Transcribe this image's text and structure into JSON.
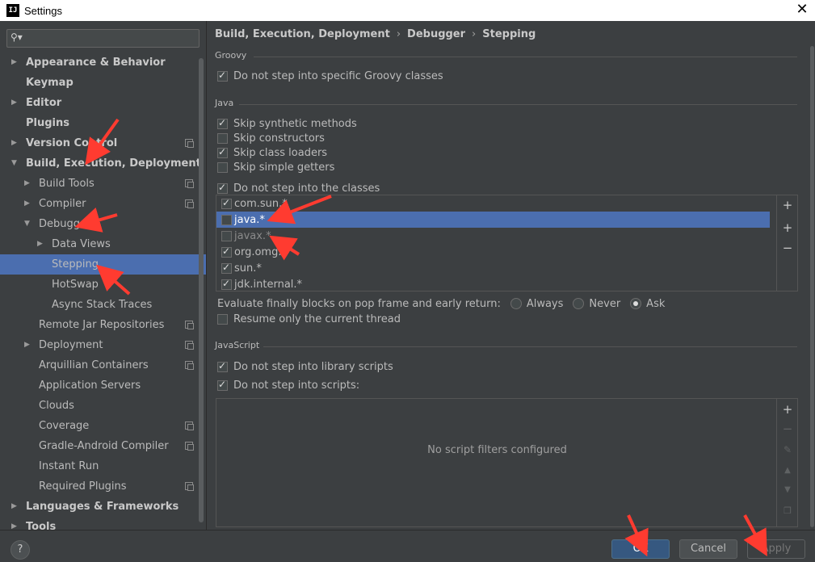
{
  "window": {
    "title": "Settings",
    "app_icon": "IJ"
  },
  "sidebar": {
    "tree": [
      {
        "label": "Appearance & Behavior",
        "level": 0,
        "expandable": true,
        "expanded": false,
        "bold": true,
        "copy": false
      },
      {
        "label": "Keymap",
        "level": 0,
        "expandable": false,
        "bold": true,
        "copy": false
      },
      {
        "label": "Editor",
        "level": 0,
        "expandable": true,
        "expanded": false,
        "bold": true,
        "copy": false
      },
      {
        "label": "Plugins",
        "level": 0,
        "expandable": false,
        "bold": true,
        "copy": false
      },
      {
        "label": "Version Control",
        "level": 0,
        "expandable": true,
        "expanded": false,
        "bold": true,
        "copy": true
      },
      {
        "label": "Build, Execution, Deployment",
        "level": 0,
        "expandable": true,
        "expanded": true,
        "bold": true,
        "copy": false
      },
      {
        "label": "Build Tools",
        "level": 1,
        "expandable": true,
        "expanded": false,
        "copy": true
      },
      {
        "label": "Compiler",
        "level": 1,
        "expandable": true,
        "expanded": false,
        "copy": true
      },
      {
        "label": "Debugger",
        "level": 1,
        "expandable": true,
        "expanded": true,
        "copy": false
      },
      {
        "label": "Data Views",
        "level": 2,
        "expandable": true,
        "expanded": false,
        "copy": false
      },
      {
        "label": "Stepping",
        "level": 2,
        "expandable": false,
        "selected": true,
        "copy": false
      },
      {
        "label": "HotSwap",
        "level": 2,
        "expandable": false,
        "copy": false
      },
      {
        "label": "Async Stack Traces",
        "level": 2,
        "expandable": false,
        "copy": false
      },
      {
        "label": "Remote Jar Repositories",
        "level": 1,
        "expandable": false,
        "copy": true
      },
      {
        "label": "Deployment",
        "level": 1,
        "expandable": true,
        "expanded": false,
        "copy": true
      },
      {
        "label": "Arquillian Containers",
        "level": 1,
        "expandable": false,
        "copy": true
      },
      {
        "label": "Application Servers",
        "level": 1,
        "expandable": false,
        "copy": false
      },
      {
        "label": "Clouds",
        "level": 1,
        "expandable": false,
        "copy": false
      },
      {
        "label": "Coverage",
        "level": 1,
        "expandable": false,
        "copy": true
      },
      {
        "label": "Gradle-Android Compiler",
        "level": 1,
        "expandable": false,
        "copy": true
      },
      {
        "label": "Instant Run",
        "level": 1,
        "expandable": false,
        "copy": false
      },
      {
        "label": "Required Plugins",
        "level": 1,
        "expandable": false,
        "copy": true
      },
      {
        "label": "Languages & Frameworks",
        "level": 0,
        "expandable": true,
        "expanded": false,
        "bold": true,
        "copy": false
      },
      {
        "label": "Tools",
        "level": 0,
        "expandable": true,
        "expanded": false,
        "bold": true,
        "copy": false
      }
    ]
  },
  "breadcrumb": [
    "Build, Execution, Deployment",
    "Debugger",
    "Stepping"
  ],
  "groovy": {
    "title": "Groovy",
    "options": [
      {
        "label": "Do not step into specific Groovy classes",
        "checked": true
      }
    ]
  },
  "java": {
    "title": "Java",
    "options": [
      {
        "label": "Skip synthetic methods",
        "checked": true
      },
      {
        "label": "Skip constructors",
        "checked": false
      },
      {
        "label": "Skip class loaders",
        "checked": true
      },
      {
        "label": "Skip simple getters",
        "checked": false
      },
      {
        "label": "Do not step into the classes",
        "checked": true
      }
    ],
    "class_filters": [
      {
        "pattern": "com.sun.*",
        "checked": true,
        "selected": false
      },
      {
        "pattern": "java.*",
        "checked": false,
        "selected": true
      },
      {
        "pattern": "javax.*",
        "checked": false,
        "selected": false
      },
      {
        "pattern": "org.omg.*",
        "checked": true,
        "selected": false
      },
      {
        "pattern": "sun.*",
        "checked": true,
        "selected": false
      },
      {
        "pattern": "jdk.internal.*",
        "checked": true,
        "selected": false
      }
    ],
    "evaluate_finally": {
      "label": "Evaluate finally blocks on pop frame and early return:",
      "choices": [
        "Always",
        "Never",
        "Ask"
      ],
      "selected": "Ask"
    },
    "resume_only_current_thread": {
      "label": "Resume only the current thread",
      "checked": false
    }
  },
  "javascript": {
    "title": "JavaScript",
    "options": [
      {
        "label": "Do not step into library scripts",
        "checked": true
      },
      {
        "label": "Do not step into scripts:",
        "checked": true
      }
    ],
    "empty_text": "No script filters configured"
  },
  "footer": {
    "help": "?",
    "ok": "OK",
    "cancel": "Cancel",
    "apply": "Apply"
  },
  "colors": {
    "selection": "#4b6eaf",
    "background": "#3c3f41",
    "annotation_arrow": "#ff3b30",
    "ok_button": "#365880"
  }
}
